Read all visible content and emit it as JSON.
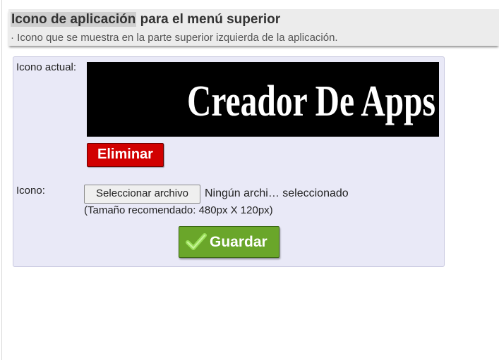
{
  "header": {
    "title_highlight": "Icono de aplicación",
    "title_rest": " para el menú superior",
    "subtitle": "· Icono que se muestra en la parte superior izquierda de la aplicación."
  },
  "form": {
    "current_icon_label": "Icono actual:",
    "current_icon_logo_text": "Creador De Apps",
    "delete_button_label": "Eliminar",
    "icon_field_label": "Icono:",
    "file_button_label": "Seleccionar archivo",
    "file_status": "Ningún archi… seleccionado",
    "size_hint": "(Tamaño recomendado: 480px X 120px)",
    "save_button_label": "Guardar"
  },
  "icons": {
    "save_icon": "checkmark-icon"
  },
  "colors": {
    "delete_button": "#d10000",
    "save_button": "#6aa62a",
    "panel_background": "#e9e9f7",
    "header_background": "#ececec"
  }
}
